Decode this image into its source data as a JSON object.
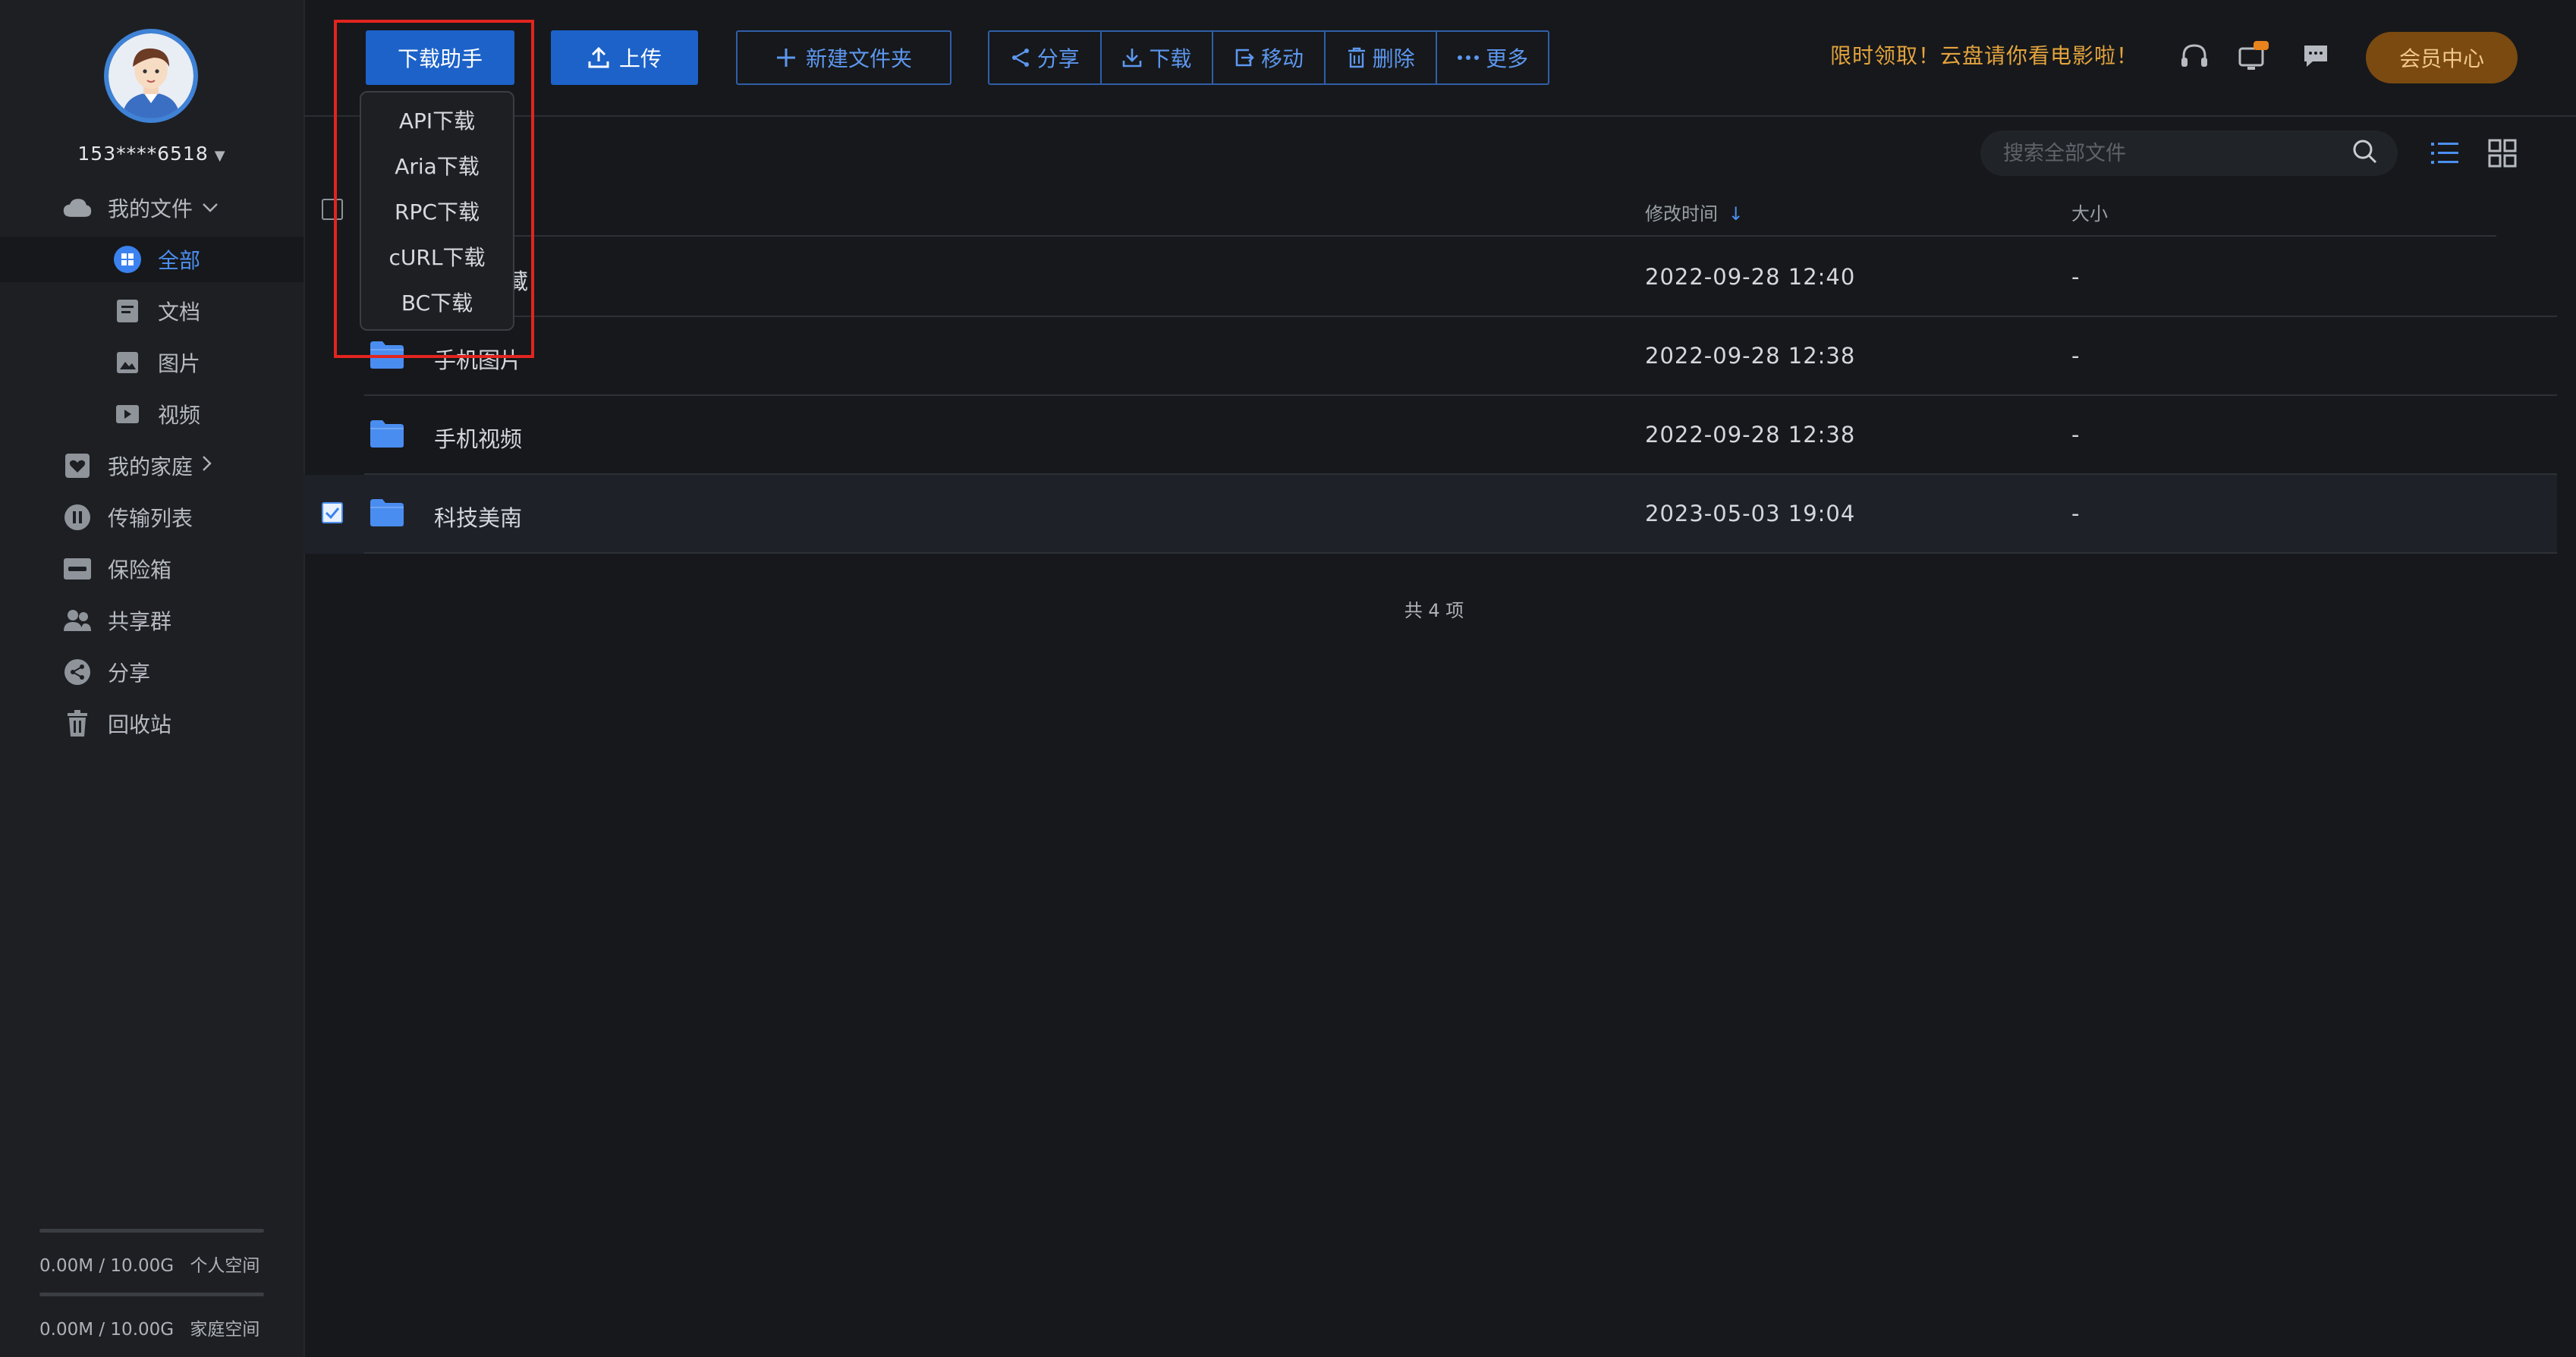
{
  "user": {
    "name": "153****6518"
  },
  "sidebar": {
    "my_files": "我的文件",
    "items": [
      {
        "label": "全部"
      },
      {
        "label": "文档"
      },
      {
        "label": "图片"
      },
      {
        "label": "视频"
      }
    ],
    "family": "我的家庭",
    "transfer": "传输列表",
    "vault": "保险箱",
    "share_group": "共享群",
    "share": "分享",
    "recycle": "回收站"
  },
  "storage": {
    "personal": "0.00M / 10.00G",
    "personal_label": "个人空间",
    "family": "0.00M / 10.00G",
    "family_label": "家庭空间"
  },
  "toolbar": {
    "download_helper": "下载助手",
    "upload": "上传",
    "new_folder": "新建文件夹",
    "share": "分享",
    "download": "下载",
    "move": "移动",
    "delete": "删除",
    "more": "更多"
  },
  "header": {
    "promo": "限时领取！云盘请你看电影啦！",
    "vip": "会员中心"
  },
  "search": {
    "placeholder": "搜索全部文件"
  },
  "dropdown": {
    "options": [
      "API下载",
      "Aria下载",
      "RPC下载",
      "cURL下载",
      "BC下载"
    ]
  },
  "table": {
    "headers": {
      "modified": "修改时间",
      "sort_arrow": "↓",
      "size": "大小"
    },
    "rows": [
      {
        "name": "收藏",
        "modified": "2022-09-28  12:40",
        "size": "-",
        "selected": false
      },
      {
        "name": "手机图片",
        "modified": "2022-09-28  12:38",
        "size": "-",
        "selected": false
      },
      {
        "name": "手机视频",
        "modified": "2022-09-28  12:38",
        "size": "-",
        "selected": false
      },
      {
        "name": "科技美南",
        "modified": "2023-05-03  19:04",
        "size": "-",
        "selected": true
      }
    ],
    "total": "共 4 项"
  },
  "colors": {
    "accent": "#4c8ff0",
    "primary_button": "#1c62c9",
    "promo": "#e3a33d",
    "vip_bg": "#7a4a10",
    "highlight": "#e2241f",
    "folder": "#4a8df0"
  }
}
